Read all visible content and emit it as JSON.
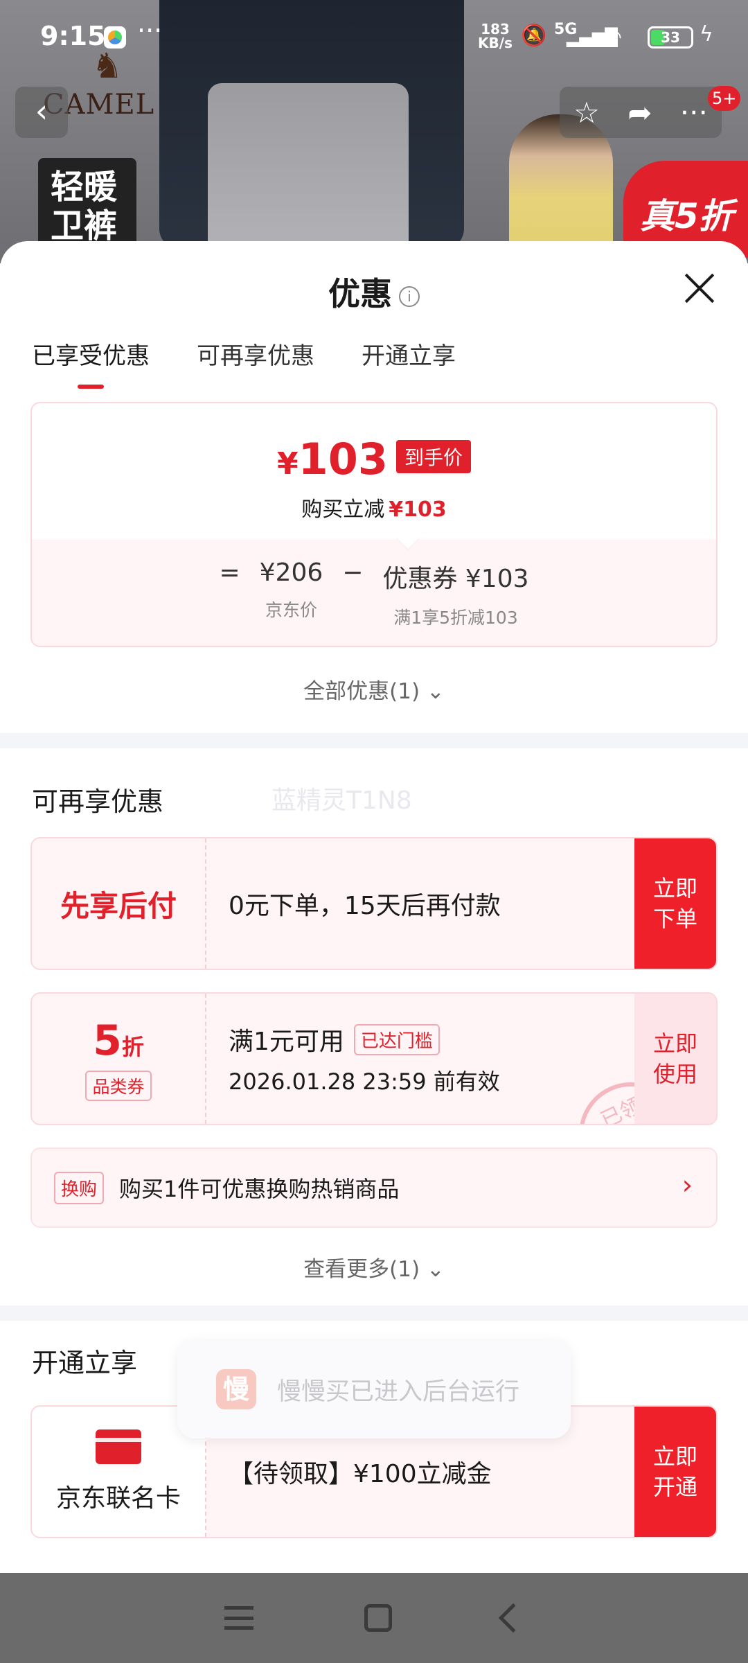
{
  "status_bar": {
    "time": "9:15",
    "more": "···",
    "net_speed_value": "183",
    "net_speed_unit": "KB/s",
    "network": "5G",
    "battery": "33",
    "battery_level": 0.33
  },
  "hero": {
    "brand": "CAMEL",
    "tag_line1": "轻暖",
    "tag_line2": "卫裤",
    "promo": "真5折"
  },
  "top_actions": {
    "badge": "5+"
  },
  "sheet": {
    "title": "优惠",
    "tabs": [
      "已享受优惠",
      "可再享优惠",
      "开通立享"
    ],
    "summary": {
      "yen": "¥",
      "final_price": "103",
      "price_tag": "到手价",
      "buy_save_label": "购买立减",
      "buy_save_amount": "¥103",
      "eq": "=",
      "original_price": "¥206",
      "original_label": "京东价",
      "minus": "−",
      "coupon_text": "优惠券 ¥103",
      "coupon_label": "满1享5折减103"
    },
    "all_deals": "全部优惠(1) ⌄",
    "more_section": {
      "title": "可再享优惠",
      "watermark": "蓝精灵T1N8",
      "pay_later": {
        "name": "先享后付",
        "desc": "0元下单，15天后再付款",
        "cta_line1": "立即",
        "cta_line2": "下单"
      },
      "coupon": {
        "discount": "5",
        "discount_unit": "折",
        "category": "品类券",
        "condition": "满1元可用",
        "reached": "已达门槛",
        "expiry": "2026.01.28 23:59 前有效",
        "stamp": "已领",
        "cta_line1": "立即",
        "cta_line2": "使用"
      },
      "swap": {
        "tag": "换购",
        "text": "购买1件可优惠换购热销商品",
        "arrow": "›"
      },
      "see_more": "查看更多(1) ⌄"
    },
    "open_section": {
      "title": "开通立享",
      "card_name": "京东联名卡",
      "offer": "【待领取】¥100立减金",
      "cta_line1": "立即",
      "cta_line2": "开通"
    },
    "toast": {
      "icon": "慢",
      "text": "慢慢买已进入后台运行"
    }
  },
  "colors": {
    "accent": "#e0202a",
    "card_bg": "#fff5f6",
    "border": "#fbd8dc"
  }
}
